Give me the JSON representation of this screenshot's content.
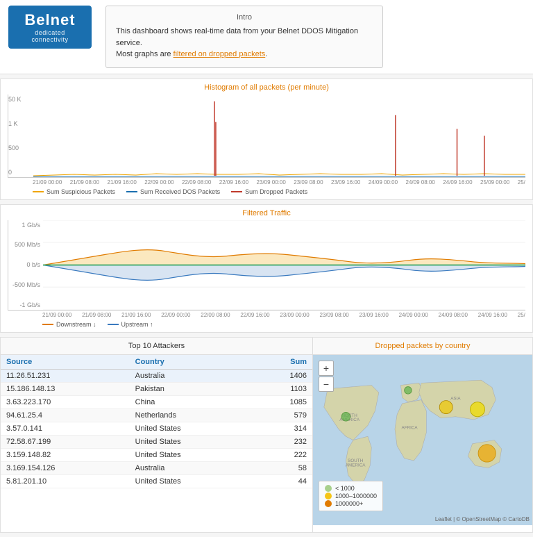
{
  "header": {
    "logo": {
      "name": "Belnet",
      "sub": "dedicated connectivity"
    },
    "intro": {
      "title": "Intro",
      "line1": "This dashboard shows real-time data from your Belnet DDOS Mitigation service.",
      "line2": "Most graphs are",
      "link_text": "filtered on dropped packets",
      "line3": "."
    }
  },
  "histogram": {
    "title": "Histogram of all packets (per minute)",
    "y_labels": [
      "50 K",
      "1 K",
      "500",
      "0"
    ],
    "x_labels": [
      "21/09 00:00",
      "21/09 08:00",
      "21/09 16:00",
      "22/09 00:00",
      "22/09 08:00",
      "22/09 16:00",
      "23/09 00:00",
      "23/09 08:00",
      "23/09 16:00",
      "24/09 00:00",
      "24/09 08:00",
      "24/09 16:00",
      "25/09 00:00",
      "25/"
    ],
    "legend": [
      {
        "label": "Sum Suspicious Packets",
        "color": "#f0a500"
      },
      {
        "label": "Sum Received DOS Packets",
        "color": "#1a6faf"
      },
      {
        "label": "Sum Dropped Packets",
        "color": "#c0392b"
      }
    ]
  },
  "filtered_traffic": {
    "title": "Filtered Traffic",
    "y_labels": [
      "1 Gb/s",
      "500 Mb/s",
      "0 b/s",
      "-500 Mb/s",
      "-1 Gb/s"
    ],
    "x_labels": [
      "21/09 00:00",
      "21/09 08:00",
      "21/09 16:00",
      "22/09 00:00",
      "22/09 08:00",
      "22/09 16:00",
      "23/09 00:00",
      "23/09 08:00",
      "23/09 16:00",
      "24/09 00:00",
      "24/09 08:00",
      "24/09 16:00",
      "25/"
    ],
    "legend": [
      {
        "label": "Downstream ↓",
        "color": "#e07b00"
      },
      {
        "label": "Upstream ↑",
        "color": "#3a7abf"
      }
    ]
  },
  "attackers_table": {
    "title": "Top 10 Attackers",
    "columns": [
      "Source",
      "Country",
      "Sum"
    ],
    "rows": [
      {
        "source": "11.26.51.231",
        "country": "Australia",
        "sum": "1406"
      },
      {
        "source": "15.186.148.13",
        "country": "Pakistan",
        "sum": "1103"
      },
      {
        "source": "3.63.223.170",
        "country": "China",
        "sum": "1085"
      },
      {
        "source": "94.61.25.4",
        "country": "Netherlands",
        "sum": "579"
      },
      {
        "source": "3.57.0.141",
        "country": "United States",
        "sum": "314"
      },
      {
        "source": "72.58.67.199",
        "country": "United States",
        "sum": "232"
      },
      {
        "source": "3.159.148.82",
        "country": "United States",
        "sum": "222"
      },
      {
        "source": "3.169.154.126",
        "country": "Australia",
        "sum": "58"
      },
      {
        "source": "5.81.201.10",
        "country": "United States",
        "sum": "44"
      }
    ]
  },
  "map": {
    "title": "Dropped packets by country",
    "controls": {
      "+": "+",
      "-": "−"
    },
    "legend": [
      {
        "label": "< 1000",
        "color": "#a8d08d"
      },
      {
        "label": "1000–1000000",
        "color": "#f5c518"
      },
      {
        "label": "1000000+",
        "color": "#e07b00"
      }
    ],
    "attribution": "Leaflet | © OpenStreetMap © CartoDB"
  }
}
